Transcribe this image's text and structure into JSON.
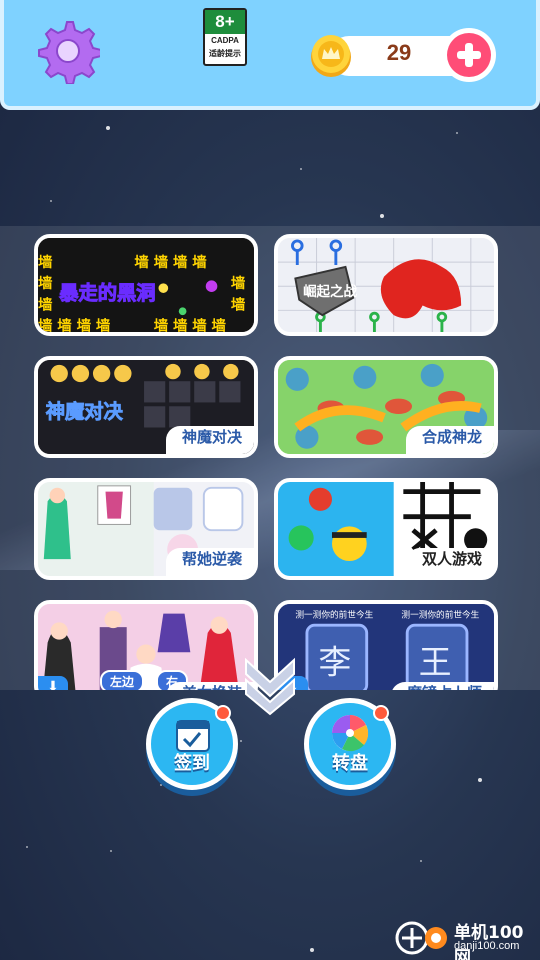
{
  "header": {
    "age_rating": {
      "rating": "8+",
      "org": "CADPA",
      "tip": "适龄提示"
    },
    "coins": "29"
  },
  "games": [
    {
      "label": "",
      "art_title": "暴走的黑洞",
      "art_text": "墙"
    },
    {
      "label": "",
      "art_title": "崛起之战"
    },
    {
      "label": "神魔对决",
      "art_title": "神魔对决"
    },
    {
      "label": "合成神龙"
    },
    {
      "label": "帮她逆袭"
    },
    {
      "label": "双人游戏"
    },
    {
      "label": "美女换装",
      "art_tags": [
        "左边",
        "右"
      ]
    },
    {
      "label": "魔镜占卜师",
      "art_caption": "测一测你的前世今生",
      "art_chars": [
        "李",
        "王"
      ]
    }
  ],
  "actions": {
    "checkin_label": "签到",
    "wheel_label": "转盘"
  },
  "watermark": {
    "name": "单机100网",
    "url": "danji100.com"
  },
  "colors": {
    "header_bg": "#7fd2ff",
    "gear": "#b36bf0",
    "plus_button": "#ff4d77",
    "action_button": "#2cb7f2",
    "notify_dot": "#ff5a3c"
  }
}
